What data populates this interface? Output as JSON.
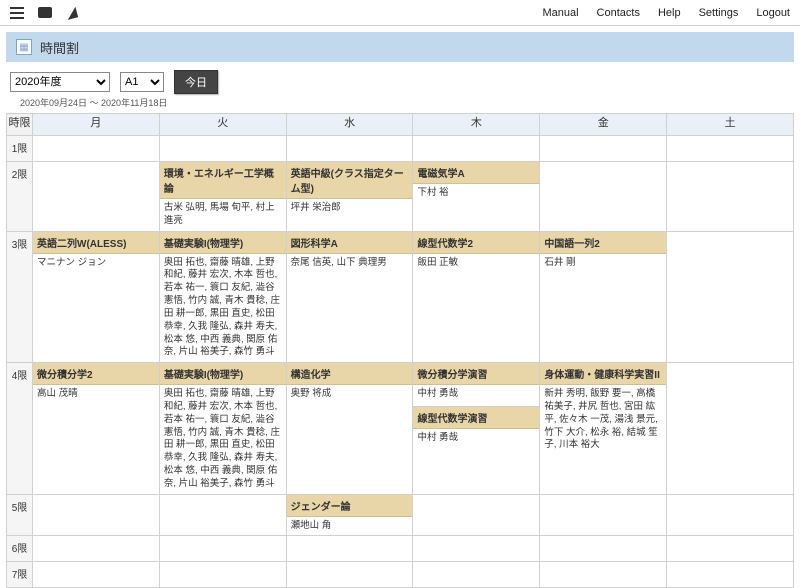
{
  "nav": {
    "links": [
      "Manual",
      "Contacts",
      "Help",
      "Settings",
      "Logout"
    ]
  },
  "page": {
    "title": "時間割"
  },
  "controls": {
    "year": "2020年度",
    "term": "A1",
    "today": "今日",
    "range": "2020年09月24日 〜 2020年11月18日"
  },
  "header": {
    "period": "時限",
    "days": [
      "月",
      "火",
      "水",
      "木",
      "金",
      "土"
    ]
  },
  "periods": [
    "1限",
    "2限",
    "3限",
    "4限",
    "5限",
    "6限",
    "7限"
  ],
  "cells": {
    "r2": {
      "tue": {
        "title": "環境・エネルギー工学概論",
        "teachers": "古米 弘明, 馬場 旬平, 村上 進亮"
      },
      "wed": {
        "title": "英語中級(クラス指定ターム型)",
        "teachers": "坪井 栄治郎"
      },
      "thu": {
        "title": "電磁気学A",
        "teachers": "下村 裕"
      }
    },
    "r3": {
      "mon": {
        "title": "英語二列W(ALESS)",
        "teachers": "マニナン ジョン"
      },
      "tue": {
        "title": "基礎実験I(物理学)",
        "teachers": "奥田 拓也, 齋藤 晴雄, 上野 和紀, 藤井 宏次, 木本 哲也, 若本 祐一, 簑口 友紀, 澁谷 憲悟, 竹内 誠, 青木 貴稔, 庄田 耕一郎, 黒田 直史, 松田 恭幸, 久我 隆弘, 森井 寿夫, 松本 悠, 中西 義典, 関原 佑奈, 片山 裕美子, 森竹 勇斗"
      },
      "wed": {
        "title": "図形科学A",
        "teachers": "奈尾 信英, 山下 典理男"
      },
      "thu": {
        "title": "線型代数学2",
        "teachers": "飯田 正敏"
      },
      "fri": {
        "title": "中国語一列2",
        "teachers": "石井 剛"
      }
    },
    "r4": {
      "mon": {
        "title": "微分積分学2",
        "teachers": "高山 茂晴"
      },
      "tue": {
        "title": "基礎実験I(物理学)",
        "teachers": "奥田 拓也, 齋藤 晴雄, 上野 和紀, 藤井 宏次, 木本 哲也, 若本 祐一, 簑口 友紀, 澁谷 憲悟, 竹内 誠, 青木 貴稔, 庄田 耕一郎, 黒田 直史, 松田 恭幸, 久我 隆弘, 森井 寿夫, 松本 悠, 中西 義典, 関原 佑奈, 片山 裕美子, 森竹 勇斗"
      },
      "wed": {
        "title": "構造化学",
        "teachers": "奥野 将成"
      },
      "thu": [
        {
          "title": "微分積分学演習",
          "teachers": "中村 勇哉"
        },
        {
          "title": "線型代数学演習",
          "teachers": "中村 勇哉"
        }
      ],
      "fri": {
        "title": "身体運動・健康科学実習II",
        "teachers": "新井 秀明, 飯野 要一, 高橋 祐美子, 井尻 哲也, 宮田 紘平, 佐々木 一茂, 湯浅 景元, 竹下 大介, 松永 裕, 結城 笙子, 川本 裕大"
      }
    },
    "r5": {
      "wed": {
        "title": "ジェンダー論",
        "teachers": "瀬地山 角"
      }
    }
  }
}
